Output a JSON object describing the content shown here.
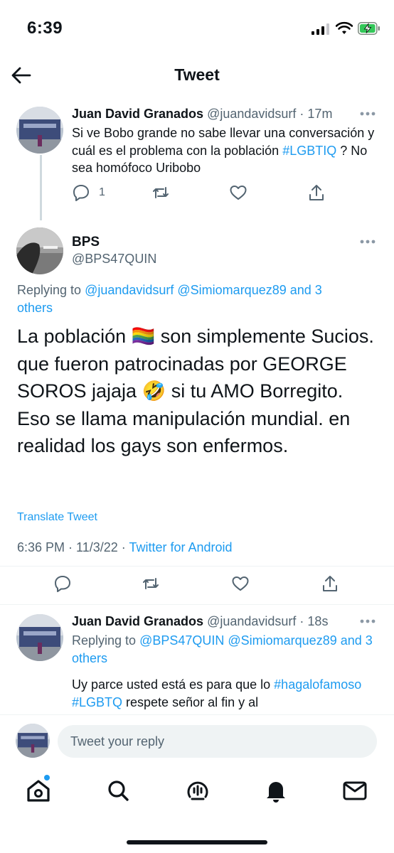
{
  "status_bar": {
    "time": "6:39"
  },
  "nav": {
    "title": "Tweet",
    "back_icon": "arrow-left-icon"
  },
  "tweets": [
    {
      "name": "Juan David Granados",
      "handle": "@juandavidsurf",
      "sep": " · ",
      "time": "17m",
      "body_parts": {
        "before": "Si ve Bobo grande no sabe llevar una conversación y cuál es el problema con la población ",
        "hashtag": "#LGBTIQ",
        "after": " ? No sea homófoco Uribobo"
      },
      "reply_count": "1"
    },
    {
      "name": "BPS",
      "handle": "@BPS47QUIN",
      "replying_label": "Replying to ",
      "replying_to": "@juandavidsurf @Simiomarquez89 and 3 others",
      "text_parts": {
        "line_a": "La población ",
        "emoji_flag": "🏳️‍🌈",
        "line_b": " son simplemente Sucios. que fueron patrocinadas por GEORGE SOROS jajaja ",
        "emoji_laugh": "🤣",
        "line_c": " si tu AMO Borregito. Eso se llama manipulación mundial. en realidad los gays son enfermos."
      },
      "translate": "Translate Tweet",
      "time": "6:36 PM",
      "date": "11/3/22",
      "source": "Twitter for Android",
      "sep": " · "
    },
    {
      "name": "Juan David Granados",
      "handle": "@juandavidsurf",
      "sep": " · ",
      "time": "18s",
      "replying_label": "Replying to ",
      "replying_to": "@BPS47QUIN @Simiomarquez89 and 3 others",
      "body_parts": {
        "before": "Uy parce usted está es para que lo ",
        "hashtag1": "#hagalofamoso",
        "space": " ",
        "hashtag2": "#LGBTQ",
        "after": " respete señor al fin y al"
      }
    }
  ],
  "composer": {
    "placeholder": "Tweet your reply"
  },
  "tabbar": {
    "items": [
      "home-icon",
      "search-icon",
      "spaces-icon",
      "notifications-icon",
      "messages-icon"
    ]
  },
  "colors": {
    "accent": "#1d9bf0",
    "secondary_text": "#536471",
    "divider": "#eff3f4"
  }
}
